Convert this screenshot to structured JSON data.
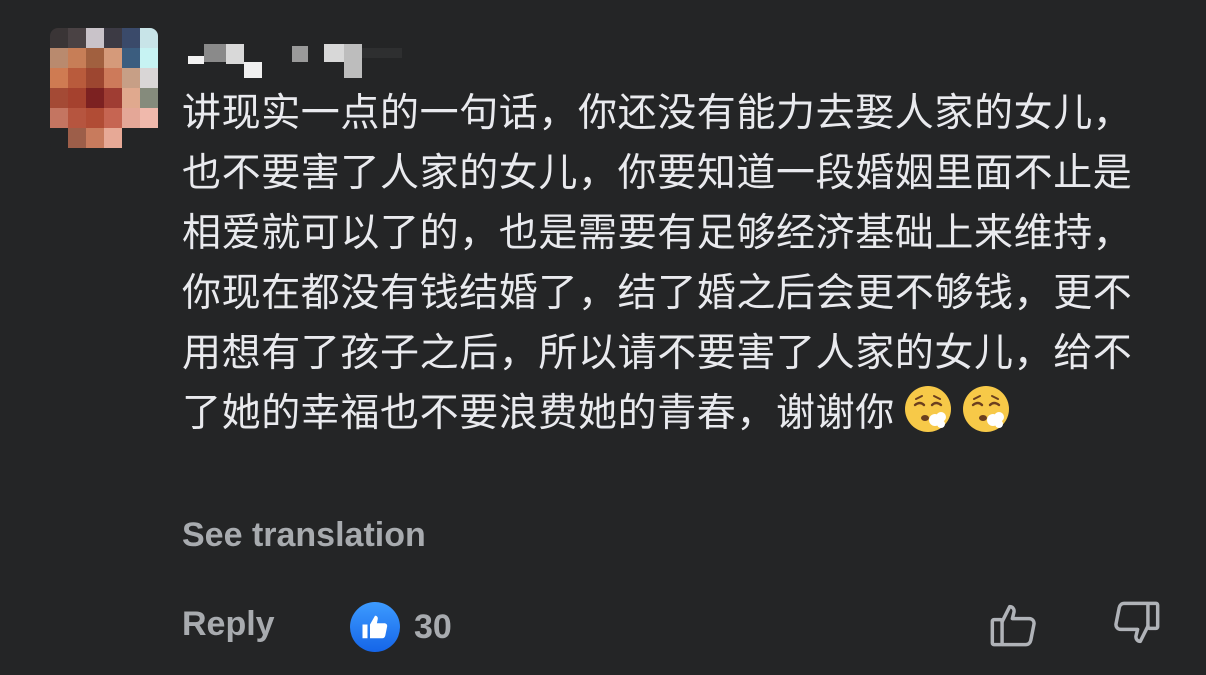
{
  "comment": {
    "text": "讲现实一点的一句话，你还没有能力去娶人家的女儿，也不要害了人家的女儿，你要知道一段婚姻里面不止是相爱就可以了的，也是需要有足够经济基础上来维持，你现在都没有钱结婚了，结了婚之后会更不够钱，更不用想有了孩子之后，所以请不要害了人家的女儿，给不了她的幸福也不要浪费她的青春，谢谢你",
    "emojis": [
      "face-exhaling-emoji",
      "face-exhaling-emoji"
    ],
    "see_translation": "See translation"
  },
  "actions": {
    "reply_label": "Reply",
    "reaction_icon": "like-reaction-icon",
    "reaction_count": "30",
    "like_button_icon": "thumbs-up-icon",
    "dislike_button_icon": "thumbs-down-icon"
  },
  "colors": {
    "background": "#242526",
    "text": "#e9eaee",
    "secondary_text": "#a8abaf",
    "like_blue": "#1877f2"
  }
}
